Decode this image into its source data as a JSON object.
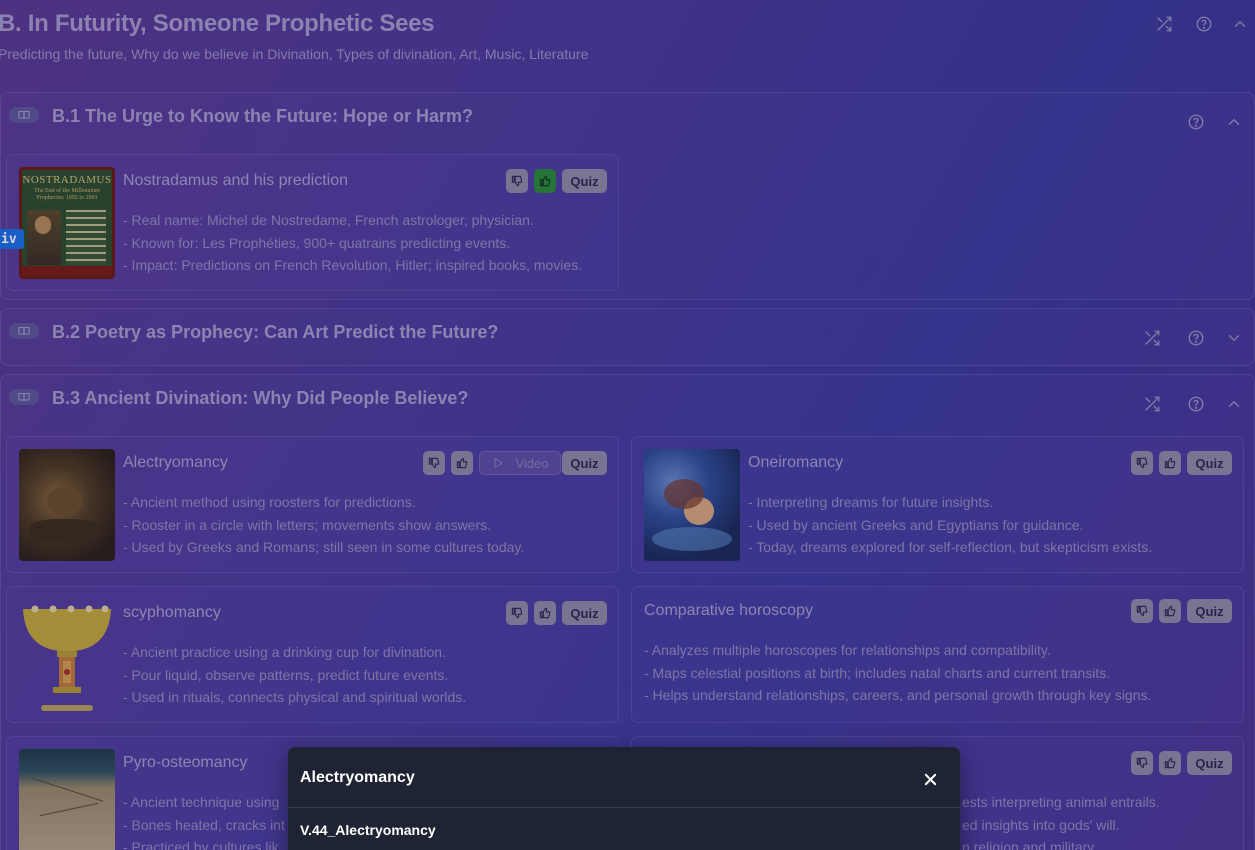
{
  "header": {
    "title": "B. In Futurity, Someone Prophetic Sees",
    "subtitle": "Predicting the future, Why do we believe in Divination, Types of divination, Art, Music, Literature"
  },
  "debug_tag": "iv",
  "sections": [
    {
      "title": "B.1 The Urge to Know the Future: Hope or Harm?",
      "expanded": true,
      "cards": [
        {
          "title": "Nostradamus and his prediction",
          "lines": [
            "- Real name: Michel de Nostredame, French astrologer, physician.",
            "- Known for: Les Prophéties, 900+ quatrains predicting events.",
            "- Impact: Predictions on French Revolution, Hitler; inspired books, movies."
          ],
          "quiz": "Quiz",
          "liked": true,
          "thumb_text": "NOSTRADAMUS",
          "thumb_sub": "The End of the Millennium Prophecies: 1992 to 2001"
        }
      ]
    },
    {
      "title": "B.2 Poetry as Prophecy: Can Art Predict the Future?",
      "expanded": false
    },
    {
      "title": "B.3 Ancient Divination: Why Did People Believe?",
      "expanded": true,
      "cards": [
        {
          "title": "Alectryomancy",
          "lines": [
            "- Ancient method using roosters for predictions.",
            "- Rooster in a circle with letters; movements show answers.",
            "- Used by Greeks and Romans; still seen in some cultures today."
          ],
          "quiz": "Quiz",
          "video": "Video"
        },
        {
          "title": "Oneiromancy",
          "lines": [
            "- Interpreting dreams for future insights.",
            "- Used by ancient Greeks and Egyptians for guidance.",
            "- Today, dreams explored for self-reflection, but skepticism exists."
          ],
          "quiz": "Quiz"
        },
        {
          "title": "scyphomancy",
          "lines": [
            "- Ancient practice using a drinking cup for divination.",
            "- Pour liquid, observe patterns, predict future events.",
            "- Used in rituals, connects physical and spiritual worlds."
          ],
          "quiz": "Quiz"
        },
        {
          "title": "Comparative horoscopy",
          "lines": [
            "- Analyzes multiple horoscopes for relationships and compatibility.",
            "- Maps celestial positions at birth; includes natal charts and current transits.",
            "- Helps understand relationships, careers, and personal growth through key signs."
          ],
          "quiz": "Quiz"
        },
        {
          "title": "Pyro-osteomancy",
          "lines": [
            "- Ancient technique using",
            "- Bones heated, cracks int",
            "- Practiced by cultures lik"
          ],
          "quiz": "Quiz"
        },
        {
          "title": "",
          "lines": [
            "ests interpreting animal entrails.",
            "ed insights into gods' will.",
            "n religion and military."
          ],
          "quiz": "Quiz"
        }
      ]
    }
  ],
  "modal": {
    "title": "Alectryomancy",
    "video_name": "V.44_Alectryomancy"
  }
}
